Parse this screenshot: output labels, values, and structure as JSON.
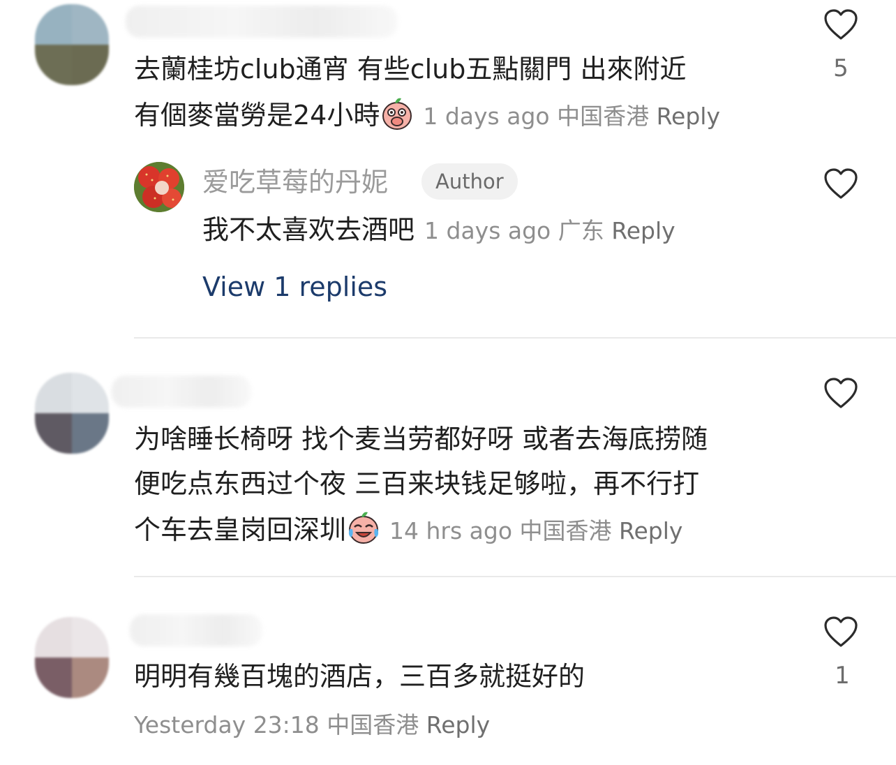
{
  "comments": [
    {
      "text_line1": "去蘭桂坊club通宵 有些club五點關門 出來附近",
      "text_line2": "有個麥當勞是24小時",
      "time": "1 days ago",
      "location": "中国香港",
      "reply_label": "Reply",
      "like_count": "5",
      "emoji_icon": "covering-mouth-emoji-icon"
    },
    {
      "text_line1": "为啥睡长椅呀 找个麦当劳都好呀 或者去海底捞随",
      "text_line2": "便吃点东西过个夜 三百来块钱足够啦，再不行打",
      "text_line3": "个车去皇岗回深圳",
      "time": "14 hrs ago",
      "location": "中国香港",
      "reply_label": "Reply",
      "emoji_icon": "crying-laughing-emoji-icon"
    },
    {
      "text_line1": "明明有幾百塊的酒店，三百多就挺好的",
      "time": "Yesterday 23:18",
      "location": "中国香港",
      "reply_label": "Reply",
      "like_count": "1"
    }
  ],
  "reply": {
    "username": "爱吃草莓的丹妮",
    "badge": "Author",
    "text": "我不太喜欢去酒吧",
    "time": "1 days ago",
    "location": "广东",
    "reply_label": "Reply",
    "avatar_icon": "strawberry-avatar-icon"
  },
  "view_replies": "View 1 replies",
  "colors": {
    "link_blue": "#1c3b6b",
    "meta_gray": "#8e8e8e",
    "badge_bg": "#f1f1f1"
  }
}
